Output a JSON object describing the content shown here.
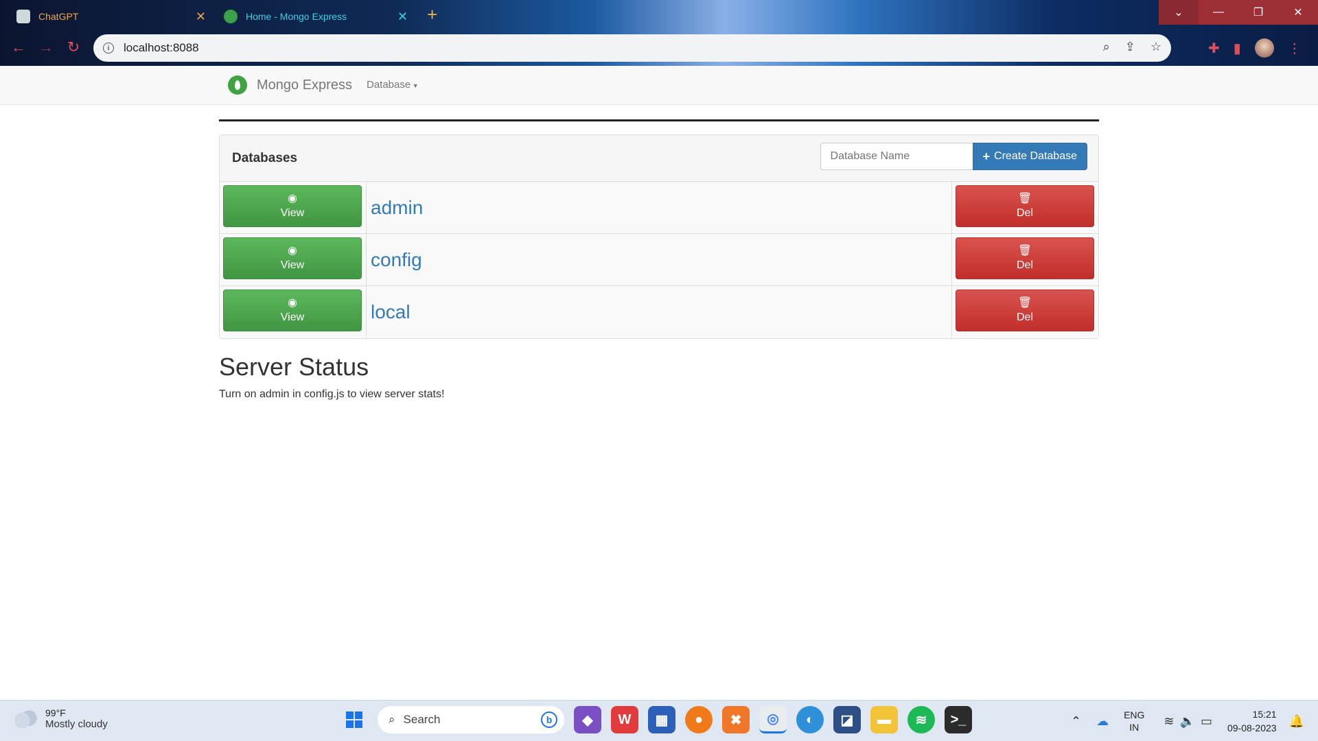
{
  "browser": {
    "tabs": [
      {
        "title": "ChatGPT",
        "active": false
      },
      {
        "title": "Home - Mongo Express",
        "active": true
      }
    ],
    "url": "localhost:8088",
    "colors": {
      "accent": "#e24d57",
      "tab_active_text": "#3ad0e6",
      "tab_inactive_text": "#f0a64b"
    }
  },
  "app": {
    "brand": "Mongo Express",
    "nav_dropdown": "Database"
  },
  "databases_panel": {
    "title": "Databases",
    "input_placeholder": "Database Name",
    "create_label": "Create Database",
    "view_label": "View",
    "del_label": "Del",
    "rows": [
      {
        "name": "admin"
      },
      {
        "name": "config"
      },
      {
        "name": "local"
      }
    ]
  },
  "server_status": {
    "heading": "Server Status",
    "message": "Turn on admin in config.js to view server stats!"
  },
  "taskbar": {
    "weather_temp": "99°F",
    "weather_desc": "Mostly cloudy",
    "search_placeholder": "Search",
    "lang_line1": "ENG",
    "lang_line2": "IN",
    "time": "15:21",
    "date": "09-08-2023"
  },
  "colors": {
    "view_button": "#5cb85c",
    "del_button": "#d9534f",
    "create_button": "#337ab7",
    "link": "#337ab7",
    "mongo_green": "#3fa33f"
  }
}
